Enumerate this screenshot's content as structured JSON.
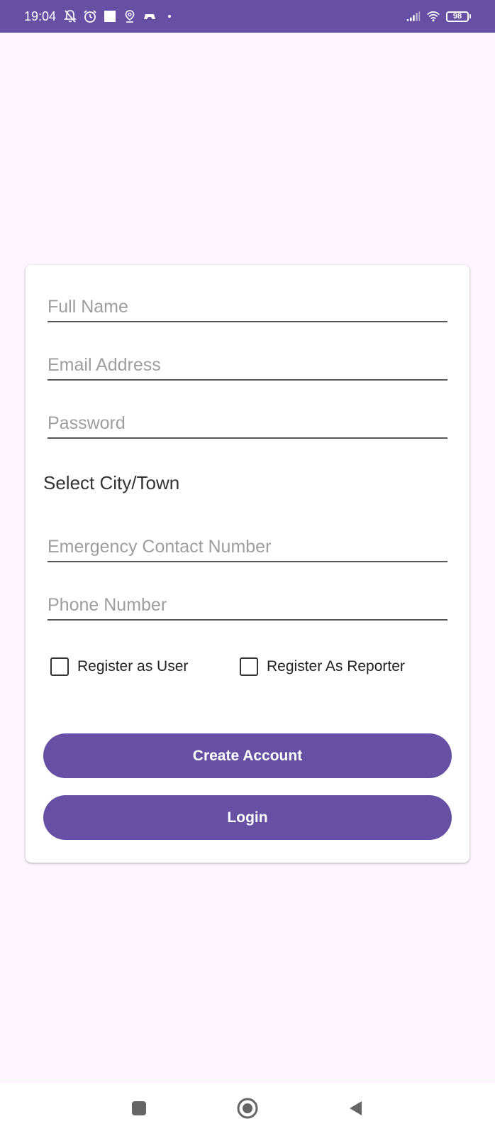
{
  "status_bar": {
    "time": "19:04",
    "battery": "98",
    "icons": [
      "mute-notifications-icon",
      "alarm-icon",
      "square-notification-icon",
      "location-icon",
      "gamepad-icon",
      "dot-icon",
      "signal-icon",
      "wifi-icon",
      "battery-icon"
    ]
  },
  "form": {
    "full_name_placeholder": "Full Name",
    "email_placeholder": "Email Address",
    "password_placeholder": "Password",
    "city_label": "Select City/Town",
    "emergency_placeholder": "Emergency Contact Number",
    "phone_placeholder": "Phone Number",
    "checkbox_user_label": "Register as User",
    "checkbox_reporter_label": "Register As Reporter",
    "checkbox_user_checked": false,
    "checkbox_reporter_checked": false,
    "create_account_label": "Create Account",
    "login_label": "Login"
  },
  "nav_bar": {
    "icons": [
      "recents-icon",
      "home-icon",
      "back-icon"
    ]
  },
  "colors": {
    "accent": "#6750a4",
    "background": "#fcf5fd",
    "card": "#ffffff"
  }
}
